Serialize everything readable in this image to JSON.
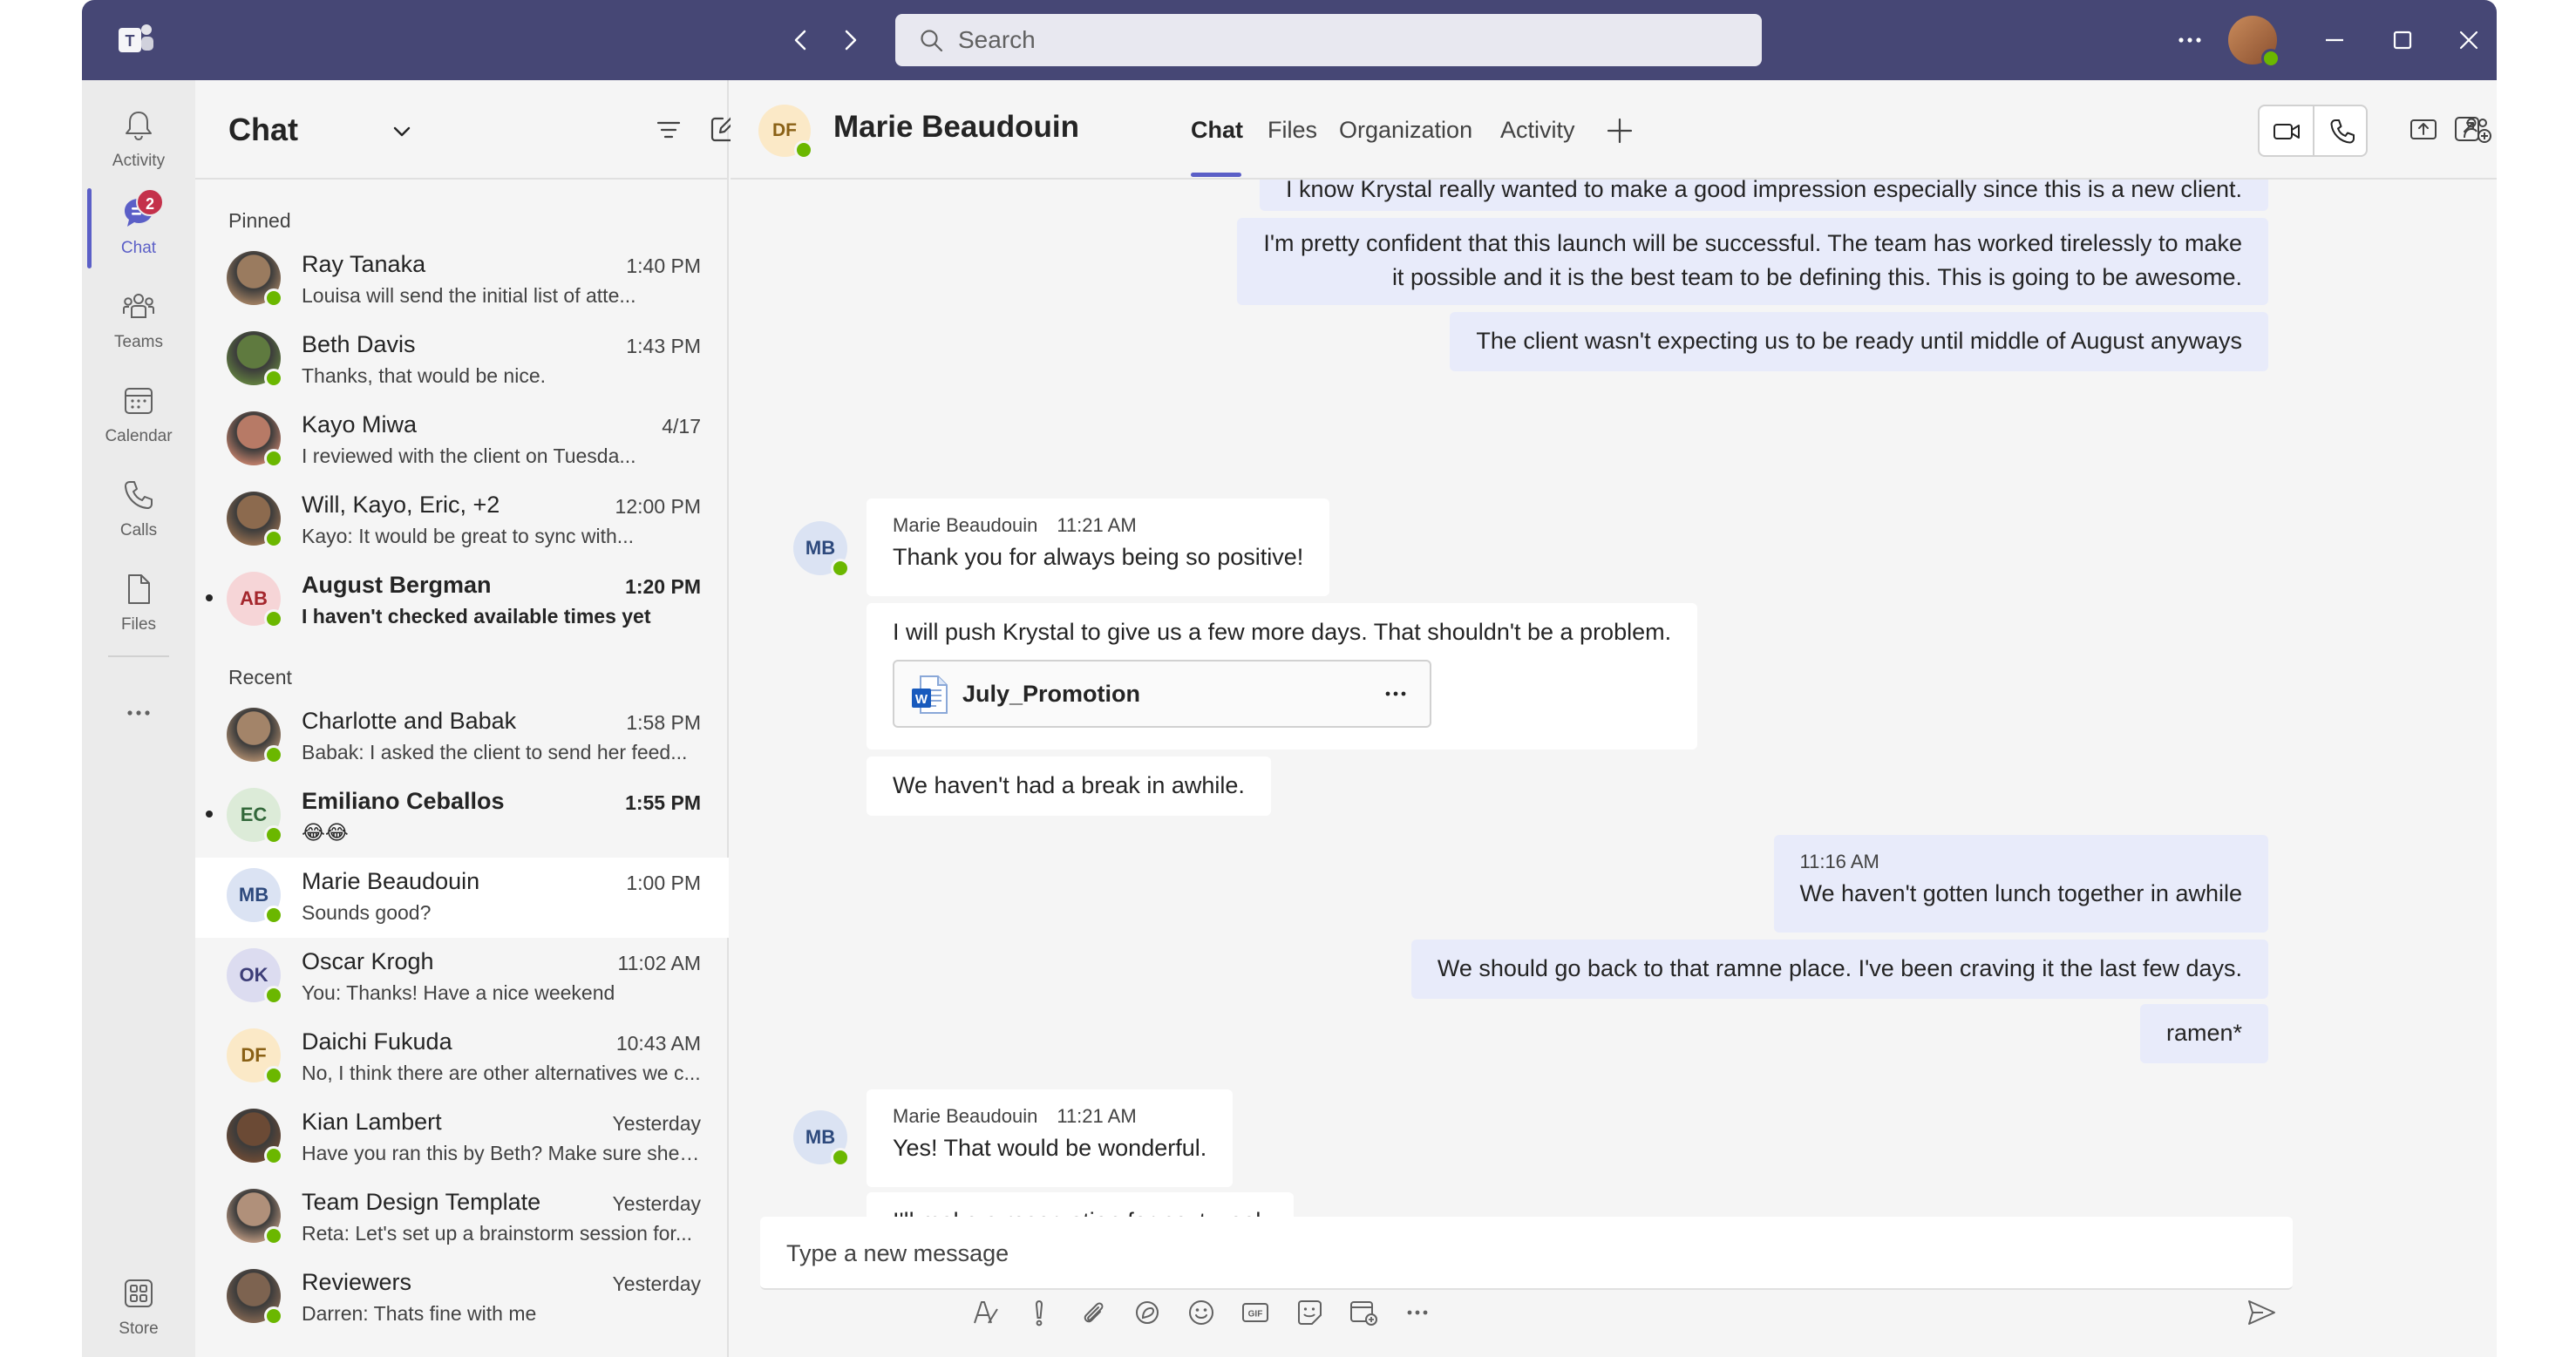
{
  "titlebar": {
    "search_placeholder": "Search"
  },
  "rail": {
    "items": [
      {
        "label": "Activity",
        "icon": "bell-icon"
      },
      {
        "label": "Chat",
        "icon": "chat-icon",
        "badge": "2"
      },
      {
        "label": "Teams",
        "icon": "teams-icon"
      },
      {
        "label": "Calendar",
        "icon": "calendar-icon"
      },
      {
        "label": "Calls",
        "icon": "phone-icon"
      },
      {
        "label": "Files",
        "icon": "file-icon"
      }
    ],
    "store_label": "Store"
  },
  "chatlist": {
    "title": "Chat",
    "pinned_label": "Pinned",
    "recent_label": "Recent",
    "pinned": [
      {
        "name": "Ray Tanaka",
        "time": "1:40 PM",
        "preview": "Louisa will send the initial list of atte...",
        "unread": false,
        "avatar": "photo",
        "color": "#9a7b5f"
      },
      {
        "name": "Beth Davis",
        "time": "1:43 PM",
        "preview": "Thanks, that would be nice.",
        "unread": false,
        "avatar": "photo",
        "color": "#5f7a3f"
      },
      {
        "name": "Kayo Miwa",
        "time": "4/17",
        "preview": "I reviewed with the client on Tuesda...",
        "unread": false,
        "avatar": "photo",
        "color": "#b77a66"
      },
      {
        "name": "Will, Kayo, Eric, +2",
        "time": "12:00 PM",
        "preview": "Kayo: It would be great to sync with...",
        "unread": false,
        "avatar": "photo",
        "color": "#8c6a4e"
      },
      {
        "name": "August Bergman",
        "time": "1:20 PM",
        "preview": "I haven't checked available times yet",
        "unread": true,
        "avatar": "AB",
        "color": "#f6d5d7",
        "textcolor": "#a4262c"
      }
    ],
    "recent": [
      {
        "name": "Charlotte and Babak",
        "time": "1:58 PM",
        "preview": "Babak: I asked the client to send her feed...",
        "unread": false,
        "avatar": "photo",
        "color": "#a38469"
      },
      {
        "name": "Emiliano Ceballos",
        "time": "1:55 PM",
        "preview": "😂😂",
        "unread": true,
        "avatar": "EC",
        "color": "#dcebd8",
        "textcolor": "#33683a"
      },
      {
        "name": "Marie Beaudouin",
        "time": "1:00 PM",
        "preview": "Sounds good?",
        "unread": false,
        "avatar": "MB",
        "color": "#dbe3f3",
        "textcolor": "#2e4a7d",
        "selected": true
      },
      {
        "name": "Oscar Krogh",
        "time": "11:02 AM",
        "preview": "You: Thanks! Have a nice weekend",
        "unread": false,
        "avatar": "OK",
        "color": "#dcdcf0",
        "textcolor": "#3d3e78"
      },
      {
        "name": "Daichi Fukuda",
        "time": "10:43 AM",
        "preview": "No, I think there are other alternatives we c...",
        "unread": false,
        "avatar": "DF",
        "color": "#fbe9c7",
        "textcolor": "#8a6116"
      },
      {
        "name": "Kian Lambert",
        "time": "Yesterday",
        "preview": "Have you ran this by Beth? Make sure she is...",
        "unread": false,
        "avatar": "photo",
        "color": "#6b4a35"
      },
      {
        "name": "Team Design Template",
        "time": "Yesterday",
        "preview": "Reta: Let's set up a brainstorm session for...",
        "unread": false,
        "avatar": "photo",
        "color": "#b0907a"
      },
      {
        "name": "Reviewers",
        "time": "Yesterday",
        "preview": "Darren: Thats fine with me",
        "unread": false,
        "avatar": "photo",
        "color": "#7d6350"
      }
    ]
  },
  "header": {
    "avatar": "DF",
    "name": "Marie Beaudouin",
    "tabs": [
      "Chat",
      "Files",
      "Organization",
      "Activity"
    ]
  },
  "messages": {
    "me_1": "I know Krystal really wanted to make a good impression especially since this is a new client.",
    "me_2a": "I'm pretty confident that this launch will be successful. The team has worked tirelessly to make",
    "me_2b": "it possible and it is the best team to be defining this. This is going to be awesome.",
    "me_3": "The client wasn't expecting us to be ready until middle of August anyways",
    "them_group1": {
      "avatar": "MB",
      "sender": "Marie Beaudouin",
      "time": "11:21 AM",
      "msg1": "Thank you for always being so positive!",
      "msg2": "I will push Krystal to give us a few more days. That shouldn't be a problem.",
      "file": "July_Promotion",
      "msg3": "We haven't had a break in awhile."
    },
    "me_group2": {
      "time": "11:16 AM",
      "msg1": "We haven't gotten lunch together in awhile",
      "msg2": "We should go back to that ramne place. I've been craving it the last few days.",
      "msg3": "ramen*"
    },
    "them_group2": {
      "avatar": "MB",
      "sender": "Marie Beaudouin",
      "time": "11:21 AM",
      "msg1": "Yes! That would be wonderful.",
      "msg2": "I'll make a reservation for next week"
    }
  },
  "compose": {
    "placeholder": "Type a new message"
  },
  "colors": {
    "titlebar": "#464775",
    "accent": "#5b5fc7",
    "my_bubble": "#e8ebfa",
    "presence": "#6bb700",
    "badge": "#c4314b"
  }
}
